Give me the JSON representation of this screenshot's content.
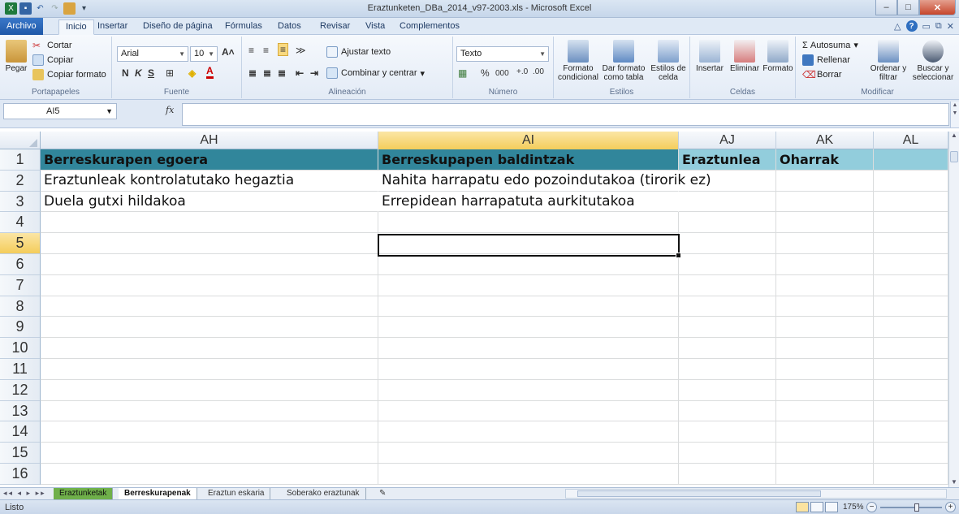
{
  "window": {
    "title": "Eraztunketen_DBa_2014_v97-2003.xls  -  Microsoft Excel",
    "minimize": "–",
    "maximize": "□",
    "close": "✕"
  },
  "tabs": {
    "file": "Archivo",
    "items": [
      "Inicio",
      "Insertar",
      "Diseño de página",
      "Fórmulas",
      "Datos",
      "Revisar",
      "Vista",
      "Complementos"
    ]
  },
  "ribbon": {
    "clipboard": {
      "paste": "Pegar",
      "cut": "Cortar",
      "copy": "Copiar",
      "format_painter": "Copiar formato",
      "label": "Portapapeles"
    },
    "font": {
      "name": "Arial",
      "size": "10",
      "bold": "N",
      "italic": "K",
      "underline": "S",
      "label": "Fuente"
    },
    "alignment": {
      "wrap": "Ajustar texto",
      "merge": "Combinar y centrar",
      "label": "Alineación"
    },
    "number": {
      "format": "Texto",
      "percent": "%",
      "thousands": "000",
      "label": "Número"
    },
    "styles": {
      "conditional": "Formato condicional",
      "as_table": "Dar formato como tabla",
      "cell_styles": "Estilos de celda",
      "label": "Estilos"
    },
    "cells": {
      "insert": "Insertar",
      "delete": "Eliminar",
      "format": "Formato",
      "label": "Celdas"
    },
    "editing": {
      "autosum": "Σ Autosuma",
      "fill": "Rellenar",
      "clear": "Borrar",
      "sort": "Ordenar y filtrar",
      "find": "Buscar y seleccionar",
      "label": "Modificar"
    }
  },
  "formula_bar": {
    "name_box": "AI5",
    "fx": "fx",
    "formula": ""
  },
  "columns": [
    "AH",
    "AI",
    "AJ",
    "AK",
    "AL"
  ],
  "selected_column": "AI",
  "selected_row": "5",
  "rows": [
    {
      "num": "1",
      "cells": [
        "Berreskurapen egoera",
        "Berreskupapen baldintzak",
        "Eraztunlea",
        "Oharrak",
        ""
      ]
    },
    {
      "num": "2",
      "cells": [
        "Eraztunleak kontrolatutako hegaztia",
        "Nahita  harrapatu edo pozoindutakoa (tirorik ez)",
        "",
        "",
        ""
      ]
    },
    {
      "num": "3",
      "cells": [
        "Duela gutxi hildakoa",
        "Errepidean harrapatuta aurkitutakoa",
        "",
        "",
        ""
      ]
    },
    {
      "num": "4",
      "cells": [
        "",
        "",
        "",
        "",
        ""
      ]
    },
    {
      "num": "5",
      "cells": [
        "",
        "",
        "",
        "",
        ""
      ]
    },
    {
      "num": "6",
      "cells": [
        "",
        "",
        "",
        "",
        ""
      ]
    },
    {
      "num": "7",
      "cells": [
        "",
        "",
        "",
        "",
        ""
      ]
    },
    {
      "num": "8",
      "cells": [
        "",
        "",
        "",
        "",
        ""
      ]
    },
    {
      "num": "9",
      "cells": [
        "",
        "",
        "",
        "",
        ""
      ]
    },
    {
      "num": "10",
      "cells": [
        "",
        "",
        "",
        "",
        ""
      ]
    },
    {
      "num": "11",
      "cells": [
        "",
        "",
        "",
        "",
        ""
      ]
    },
    {
      "num": "12",
      "cells": [
        "",
        "",
        "",
        "",
        ""
      ]
    },
    {
      "num": "13",
      "cells": [
        "",
        "",
        "",
        "",
        ""
      ]
    },
    {
      "num": "14",
      "cells": [
        "",
        "",
        "",
        "",
        ""
      ]
    },
    {
      "num": "15",
      "cells": [
        "",
        "",
        "",
        "",
        ""
      ]
    },
    {
      "num": "16",
      "cells": [
        "",
        "",
        "",
        "",
        ""
      ]
    }
  ],
  "sheets": [
    "Eraztunketak",
    "Berreskurapenak",
    "Eraztun eskaria",
    "Soberako eraztunak"
  ],
  "active_sheet": "Berreskurapenak",
  "status": {
    "text": "Listo",
    "zoom": "175%"
  },
  "colors": {
    "header_dark": "#31869b",
    "header_light": "#92cddc",
    "selection": "#f4cd5b",
    "sheet_green": "#6fb04a"
  }
}
